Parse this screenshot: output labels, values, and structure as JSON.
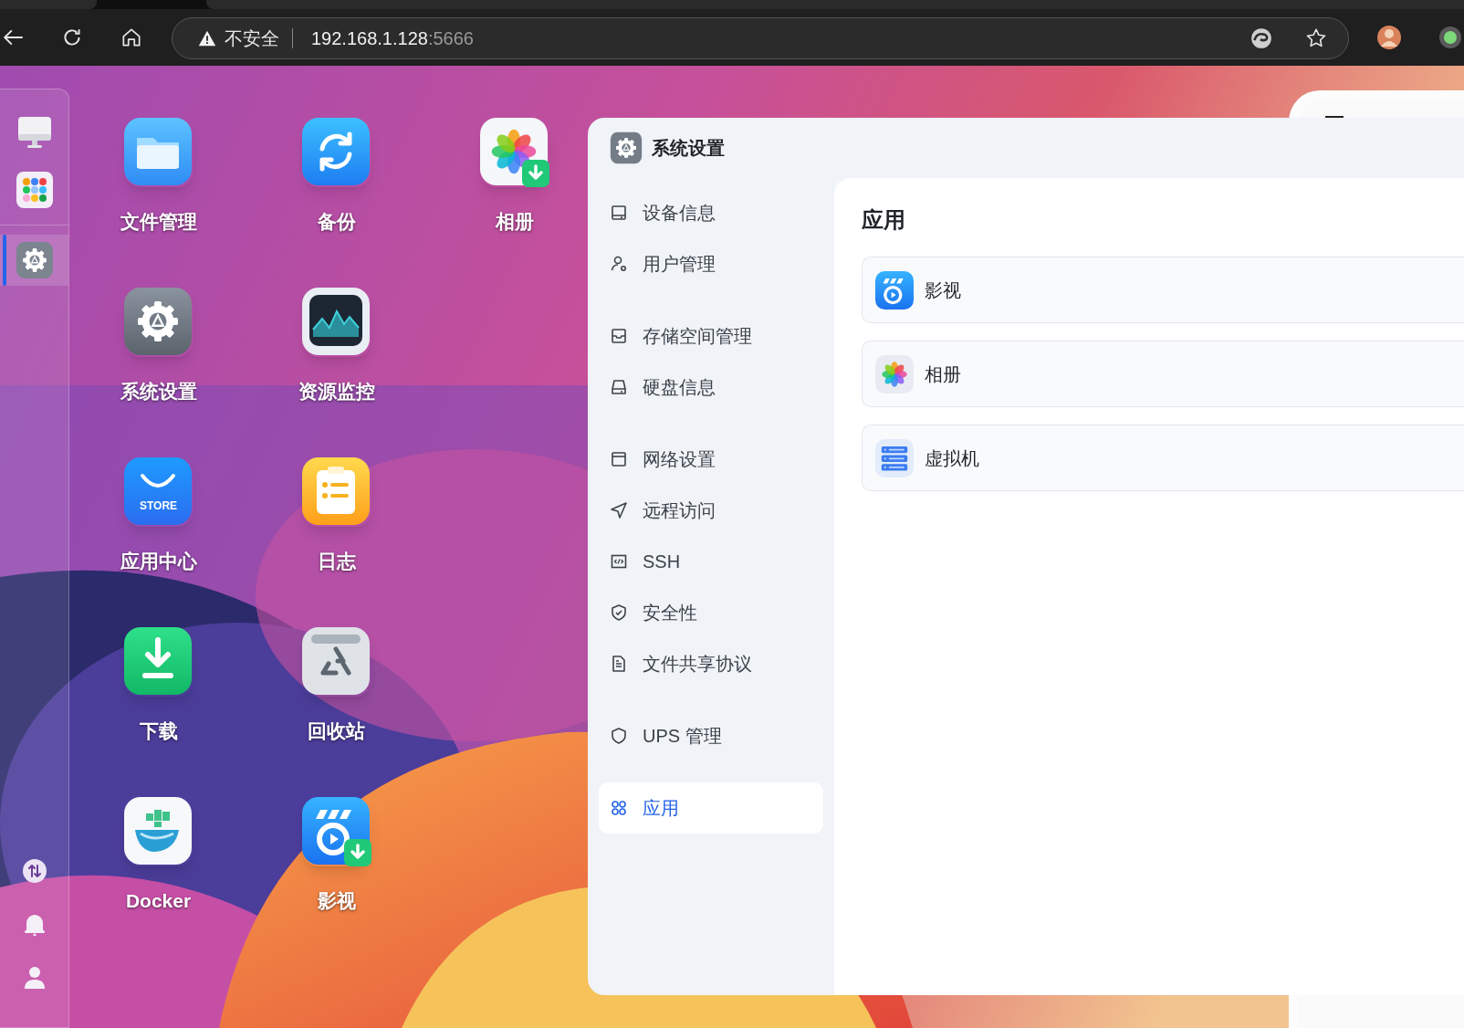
{
  "browser": {
    "security_label": "不安全",
    "url_host": "192.168.1.128",
    "url_port": ":5666"
  },
  "dock": {
    "top_items": [
      {
        "kind": "desktop",
        "selected": false
      },
      {
        "kind": "apps",
        "selected": false
      },
      {
        "kind": "settings",
        "selected": true
      }
    ],
    "bottom_items": [
      {
        "kind": "transfer"
      },
      {
        "kind": "bell"
      },
      {
        "kind": "user"
      }
    ]
  },
  "desktop_icons": [
    {
      "label": "文件管理",
      "kind": "files",
      "download_badge": false
    },
    {
      "label": "备份",
      "kind": "backup",
      "download_badge": false
    },
    {
      "label": "相册",
      "kind": "album",
      "download_badge": true
    },
    {
      "label": "系统设置",
      "kind": "settings",
      "download_badge": false
    },
    {
      "label": "资源监控",
      "kind": "monitor",
      "download_badge": false
    },
    {
      "label": "应用中心",
      "kind": "store",
      "download_badge": false,
      "icon_text": "STORE"
    },
    {
      "label": "日志",
      "kind": "log",
      "download_badge": false
    },
    {
      "label": "下载",
      "kind": "download",
      "download_badge": false
    },
    {
      "label": "回收站",
      "kind": "recycle",
      "download_badge": false
    },
    {
      "label": "Docker",
      "kind": "docker",
      "download_badge": false
    },
    {
      "label": "影视",
      "kind": "video",
      "download_badge": true
    }
  ],
  "settings_window": {
    "title": "系统设置",
    "sidebar_groups": [
      [
        {
          "label": "设备信息",
          "kind": "device",
          "selected": false
        },
        {
          "label": "用户管理",
          "kind": "user",
          "selected": false
        }
      ],
      [
        {
          "label": "存储空间管理",
          "kind": "storage",
          "selected": false
        },
        {
          "label": "硬盘信息",
          "kind": "disk",
          "selected": false
        }
      ],
      [
        {
          "label": "网络设置",
          "kind": "network",
          "selected": false
        },
        {
          "label": "远程访问",
          "kind": "remote",
          "selected": false
        },
        {
          "label": "SSH",
          "kind": "ssh",
          "selected": false
        },
        {
          "label": "安全性",
          "kind": "security",
          "selected": false
        },
        {
          "label": "文件共享协议",
          "kind": "share",
          "selected": false
        }
      ],
      [
        {
          "label": "UPS 管理",
          "kind": "ups",
          "selected": false
        }
      ],
      [
        {
          "label": "应用",
          "kind": "apps",
          "selected": true
        }
      ]
    ],
    "content": {
      "heading": "应用",
      "apps": [
        {
          "label": "影视",
          "kind": "video"
        },
        {
          "label": "相册",
          "kind": "album"
        },
        {
          "label": "虚拟机",
          "kind": "vm"
        }
      ]
    }
  }
}
